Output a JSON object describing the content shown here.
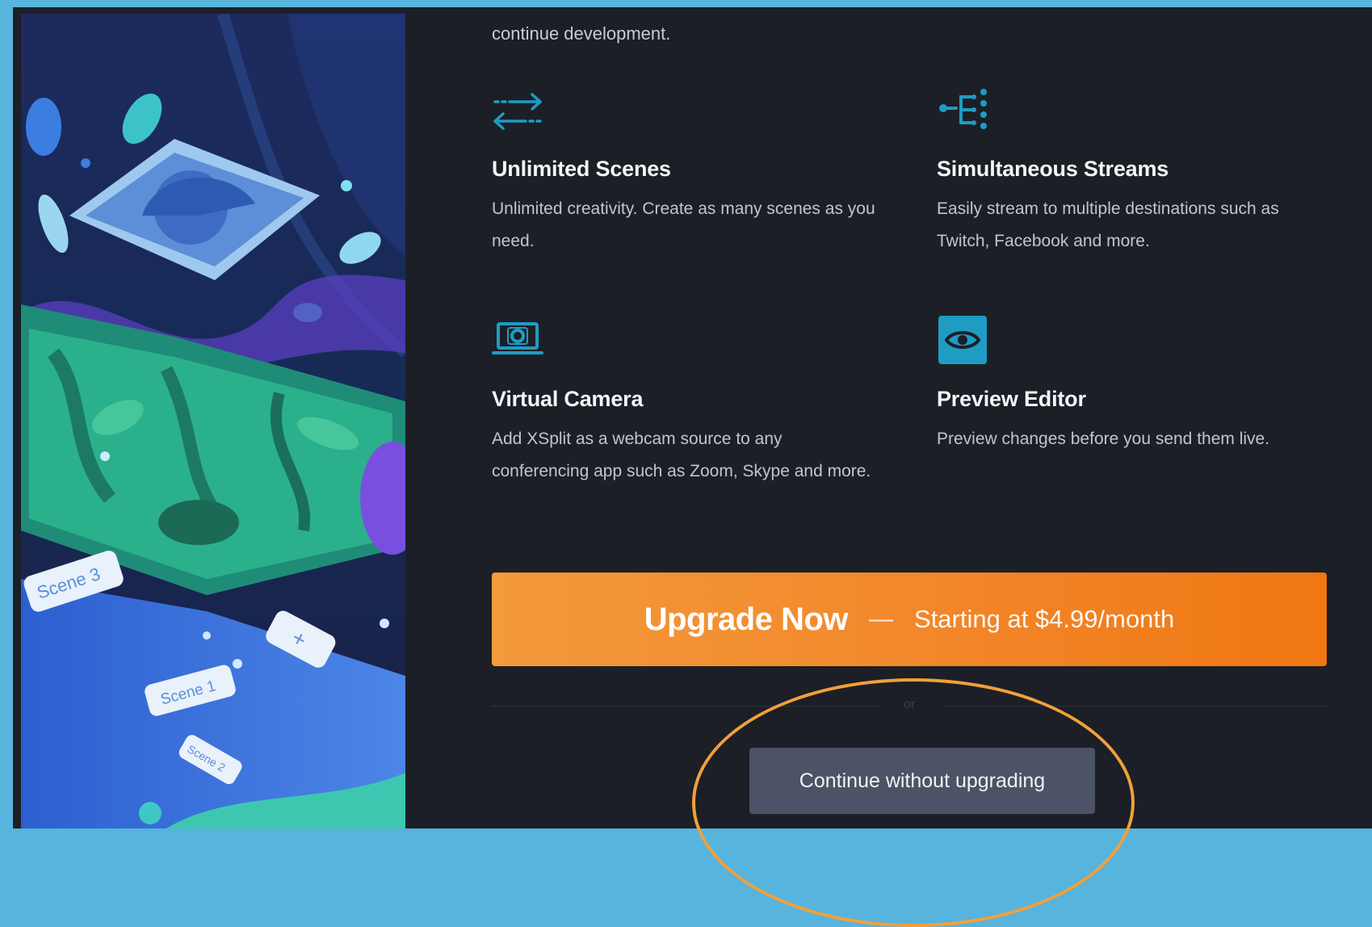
{
  "intro": {
    "text": "continue development."
  },
  "features": [
    {
      "title": "Unlimited Scenes",
      "desc": "Unlimited creativity. Create as many scenes as you need.",
      "icon": "arrows-swap-icon"
    },
    {
      "title": "Simultaneous Streams",
      "desc": "Easily stream to multiple destinations such as Twitch, Facebook and more.",
      "icon": "multi-stream-icon"
    },
    {
      "title": "Virtual Camera",
      "desc": "Add XSplit as a webcam source to any conferencing app such as Zoom, Skype and more.",
      "icon": "laptop-camera-icon"
    },
    {
      "title": "Preview Editor",
      "desc": "Preview changes before you send them live.",
      "icon": "eye-icon"
    }
  ],
  "upgrade": {
    "label": "Upgrade Now",
    "dash": "—",
    "price": "Starting at $4.99/month"
  },
  "divider": {
    "text": "or"
  },
  "continue": {
    "label": "Continue without upgrading"
  },
  "artwork": {
    "tags": [
      "Scene 3",
      "Scene 1",
      "Scene 2",
      "+"
    ]
  },
  "colors": {
    "accent": "#f2862a",
    "icon": "#1e9cc4",
    "background": "#1c1f26",
    "frame": "#56b4dd"
  }
}
